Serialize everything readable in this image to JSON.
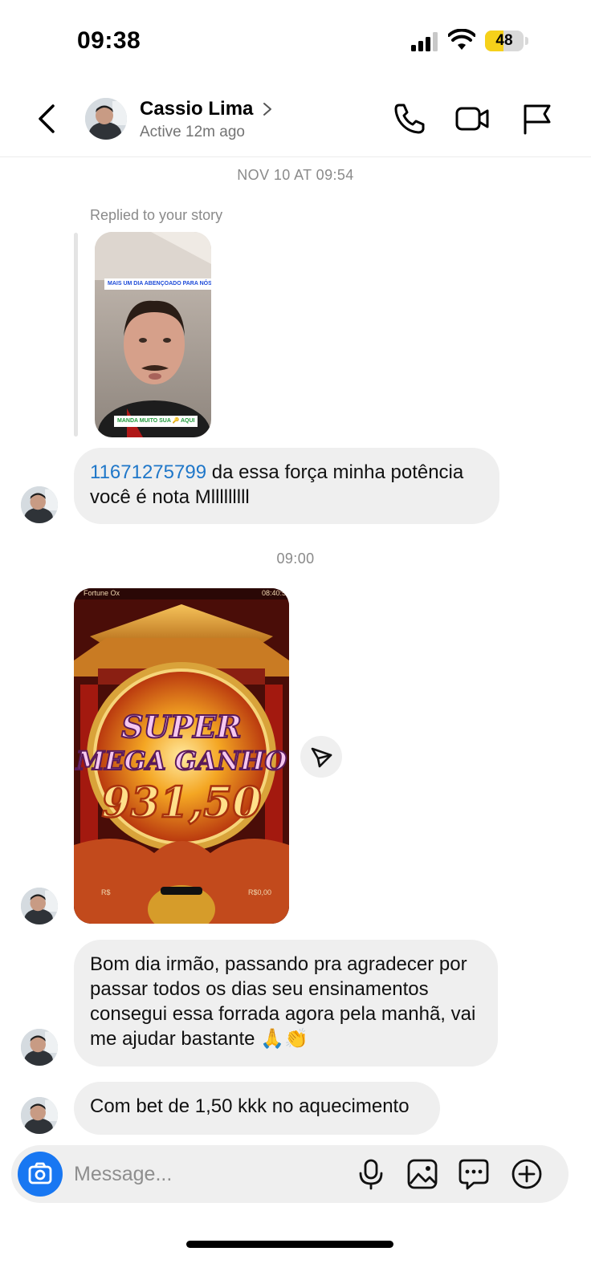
{
  "status_bar": {
    "time": "09:38",
    "battery_level": "48",
    "battery_fraction": 0.48,
    "battery_color": "#f6d11a"
  },
  "header": {
    "name": "Cassio Lima",
    "status": "Active 12m ago",
    "icons": [
      "back-icon",
      "phone-icon",
      "video-camera-icon",
      "flag-icon"
    ]
  },
  "chat": {
    "timestamp_1": "NOV 10 AT 09:54",
    "reply_label": "Replied to your story",
    "story": {
      "top_caption": "MAIS UM DIA ABENÇOADO PARA NÓS 🔥",
      "bottom_caption": "MANDA MUITO SUA 🔑 AQUI"
    },
    "message_1": {
      "mention": "11671275799",
      "text": " da essa força minha potência você é nota Mlllllllll"
    },
    "timestamp_2": "09:00",
    "game_image": {
      "top_left": "Fortune Ox",
      "top_right": "08:40:5",
      "line1": "SUPER",
      "line2": "MEGA GANHO",
      "amount": "931,50",
      "bottom_left": "R$",
      "bottom_right": "R$0,00"
    },
    "message_3": "Bom dia irmão, passando pra agradecer por passar  todos os dias seu ensinamentos consegui essa forrada agora pela manhã, vai me ajudar bastante 🙏👏",
    "message_4": "Com bet de 1,50 kkk no aquecimento"
  },
  "composer": {
    "placeholder": "Message...",
    "icons": [
      "camera-icon",
      "microphone-icon",
      "gallery-icon",
      "sticker-icon",
      "plus-icon"
    ]
  },
  "colors": {
    "accent": "#1877f2",
    "mention": "#1f77c9",
    "bubble": "#efefef"
  }
}
